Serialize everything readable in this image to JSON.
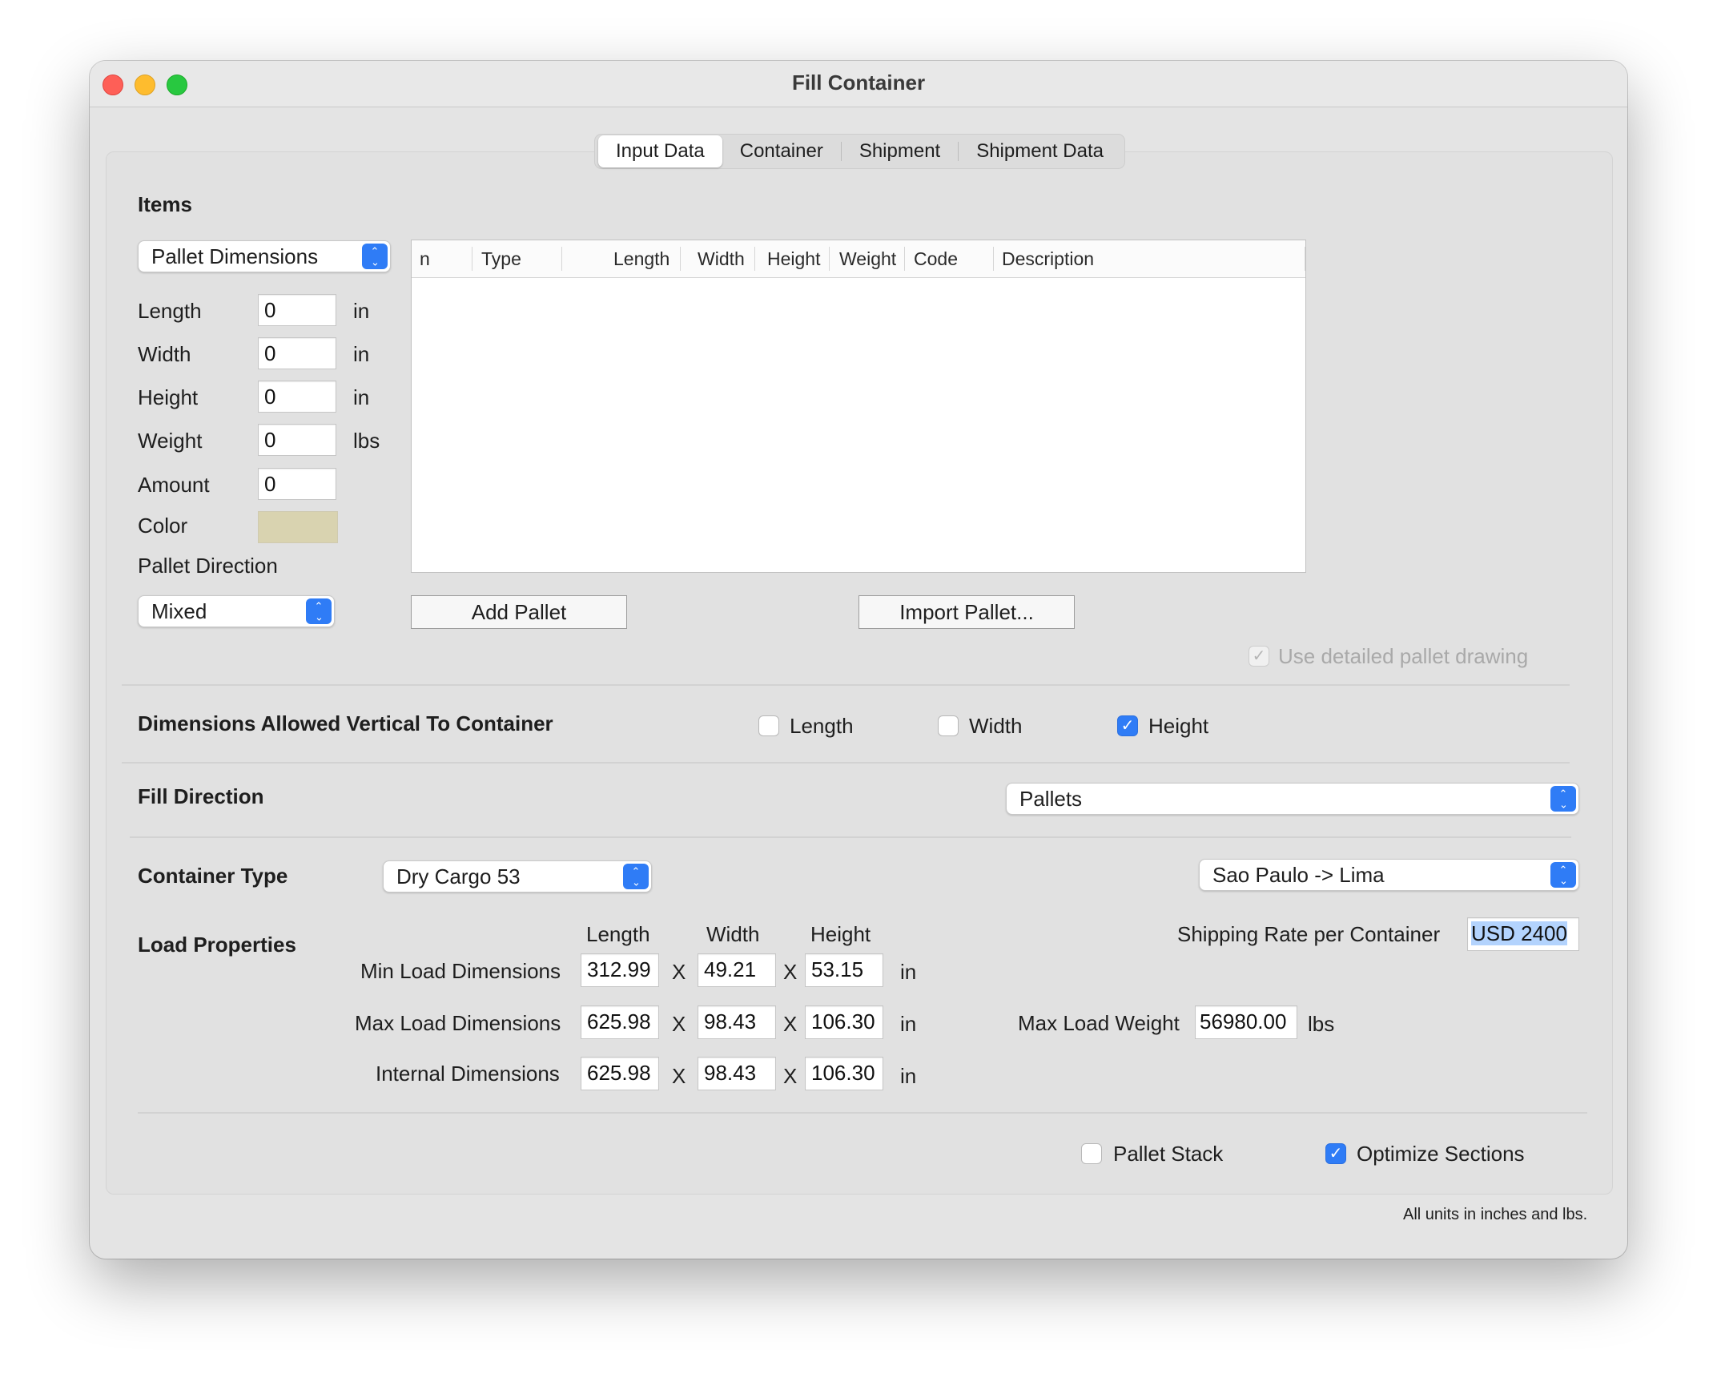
{
  "window": {
    "title": "Fill Container"
  },
  "tabs": [
    "Input Data",
    "Container",
    "Shipment",
    "Shipment Data"
  ],
  "items": {
    "heading": "Items",
    "type_popup": "Pallet Dimensions",
    "fields": [
      {
        "label": "Length",
        "value": "0",
        "unit": "in"
      },
      {
        "label": "Width",
        "value": "0",
        "unit": "in"
      },
      {
        "label": "Height",
        "value": "0",
        "unit": "in"
      },
      {
        "label": "Weight",
        "value": "0",
        "unit": "lbs"
      },
      {
        "label": "Amount",
        "value": "0",
        "unit": ""
      }
    ],
    "color_label": "Color",
    "color_value": "#d9d3b0",
    "pallet_direction_label": "Pallet Direction",
    "pallet_direction_value": "Mixed",
    "table_columns": [
      "n",
      "Type",
      "Length",
      "Width",
      "Height",
      "Weight",
      "Code",
      "Description"
    ],
    "add_button": "Add Pallet",
    "import_button": "Import Pallet...",
    "detailed_drawing": {
      "label": "Use detailed pallet drawing",
      "checked": true,
      "enabled": false
    }
  },
  "vertical": {
    "heading": "Dimensions Allowed Vertical To Container",
    "options": [
      {
        "label": "Length",
        "checked": false
      },
      {
        "label": "Width",
        "checked": false
      },
      {
        "label": "Height",
        "checked": true
      }
    ]
  },
  "fill_direction": {
    "heading": "Fill Direction",
    "value": "Pallets"
  },
  "container": {
    "heading": "Container Type",
    "type_value": "Dry Cargo 53",
    "route_value": "Sao Paulo -> Lima",
    "rate_label": "Shipping Rate per Container",
    "rate_value": "USD 2400"
  },
  "load": {
    "heading": "Load Properties",
    "col_headers": [
      "Length",
      "Width",
      "Height"
    ],
    "rows": [
      {
        "label": "Min Load Dimensions",
        "length": "312.99",
        "width": "49.21",
        "height": "53.15",
        "unit": "in"
      },
      {
        "label": "Max Load Dimensions",
        "length": "625.98",
        "width": "98.43",
        "height": "106.30",
        "unit": "in"
      },
      {
        "label": "Internal Dimensions",
        "length": "625.98",
        "width": "98.43",
        "height": "106.30",
        "unit": "in"
      }
    ],
    "x_symbol": "X",
    "max_weight_label": "Max Load Weight",
    "max_weight_value": "56980.00",
    "max_weight_unit": "lbs"
  },
  "options": {
    "pallet_stack": {
      "label": "Pallet Stack",
      "checked": false
    },
    "optimize_sections": {
      "label": "Optimize Sections",
      "checked": true
    }
  },
  "footer_note": "All units in inches and lbs.",
  "check_glyph": "✓"
}
